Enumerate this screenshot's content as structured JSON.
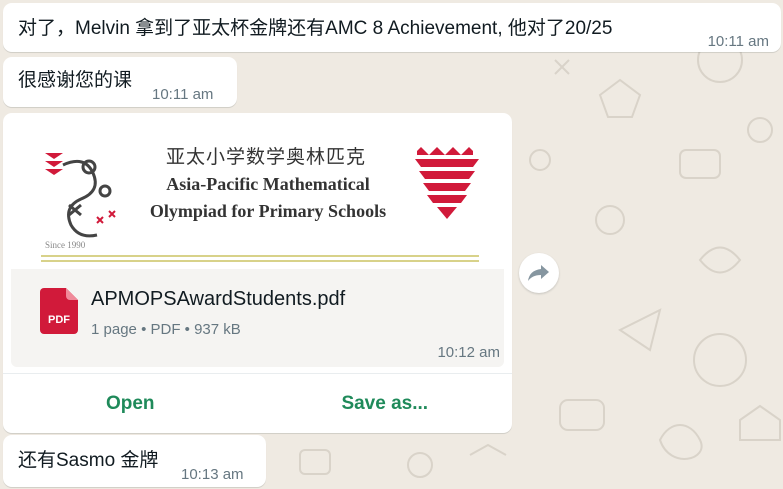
{
  "messages": [
    {
      "text": "对了，Melvin 拿到了亚太杯金牌还有AMC 8 Achievement, 他对了20/25",
      "time": "10:11 am"
    },
    {
      "text": "很感谢您的课",
      "time": "10:11 am"
    },
    {
      "attachment": {
        "preview": {
          "title_cn": "亚太小学数学奥林匹克",
          "title_en_line1": "Asia-Pacific Mathematical",
          "title_en_line2": "Olympiad for Primary Schools",
          "since": "Since 1990"
        },
        "file_icon_label": "PDF",
        "file_name": "APMOPSAwardStudents.pdf",
        "pages": "1 page",
        "type": "PDF",
        "size": "937 kB",
        "time": "10:12 am",
        "actions": {
          "open": "Open",
          "save": "Save as..."
        }
      }
    },
    {
      "text": "还有Sasmo 金牌",
      "time": "10:13 am"
    }
  ],
  "icons": {
    "forward": "forward-icon",
    "pdf": "pdf-file-icon"
  },
  "colors": {
    "background": "#efeae2",
    "accent_green": "#1f8a5a",
    "pdf_red": "#d11a3a"
  }
}
